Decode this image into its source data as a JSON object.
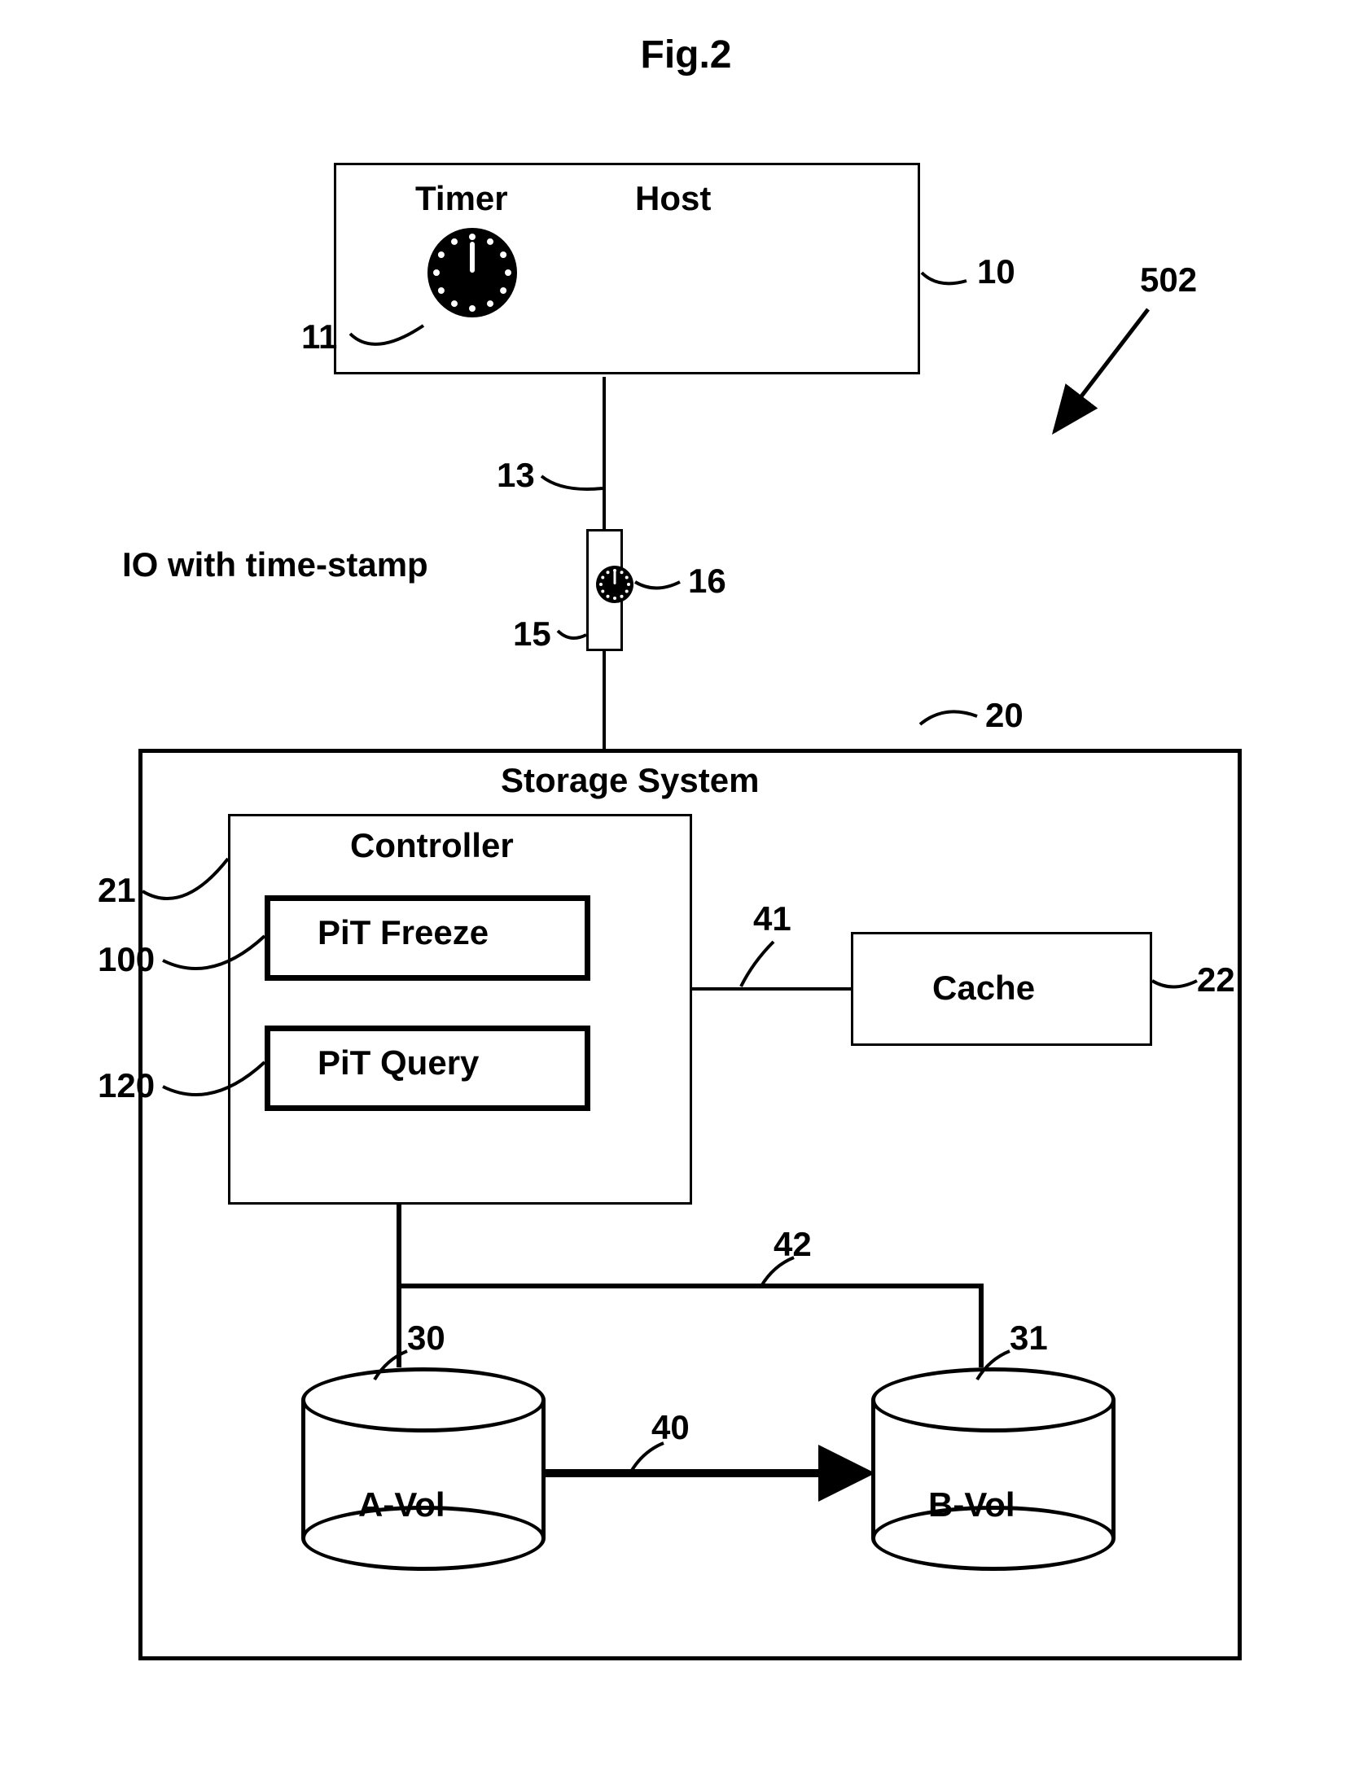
{
  "figure_title": "Fig.2",
  "host": {
    "label": "Host",
    "timer_label": "Timer",
    "ref_host": "10",
    "ref_timer": "11"
  },
  "io": {
    "label": "IO with time-stamp",
    "ref_line": "13",
    "ref_rect": "15",
    "ref_clock": "16"
  },
  "system_ref": "502",
  "storage": {
    "label": "Storage System",
    "ref": "20",
    "controller": {
      "label": "Controller",
      "ref": "21",
      "pit_freeze": "PiT Freeze",
      "pit_freeze_ref": "100",
      "pit_query": "PiT Query",
      "pit_query_ref": "120"
    },
    "cache": {
      "label": "Cache",
      "ref": "22"
    },
    "conn_controller_cache_ref": "41",
    "conn_controller_bvol_ref": "42",
    "avol": {
      "label": "A-Vol",
      "ref": "30"
    },
    "bvol": {
      "label": "B-Vol",
      "ref": "31"
    },
    "avol_to_bvol_ref": "40"
  }
}
